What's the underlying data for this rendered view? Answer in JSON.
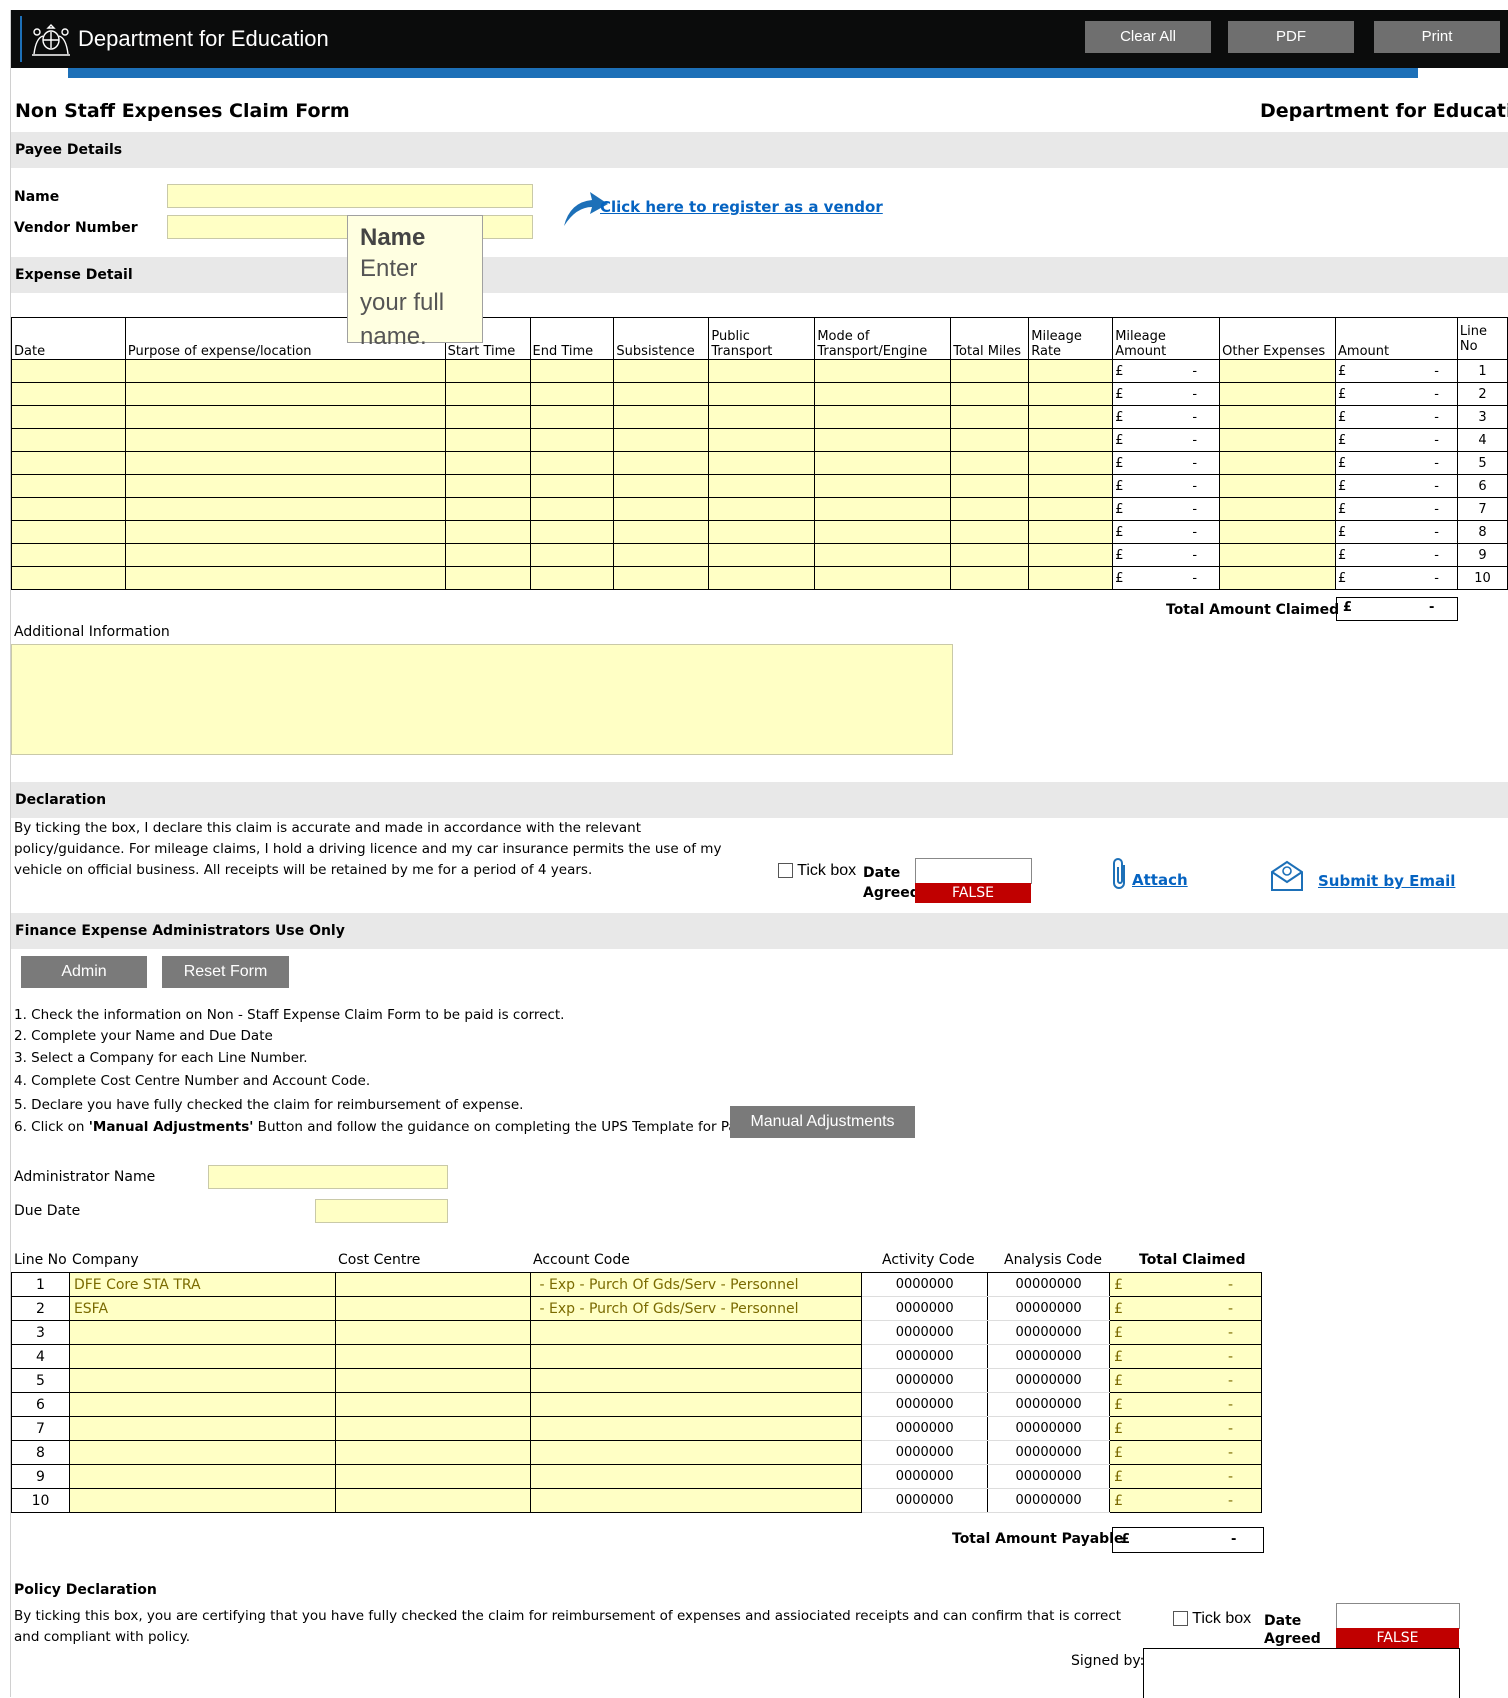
{
  "header": {
    "dept_name": "Department for Education",
    "buttons": [
      "Clear All",
      "PDF",
      "Print"
    ]
  },
  "form": {
    "title": "Non Staff Expenses Claim Form",
    "org": "Department for Education"
  },
  "payee": {
    "section": "Payee Details",
    "name_label": "Name",
    "vendor_label": "Vendor Number",
    "register_link": "Click here to register as a vendor",
    "tooltip_title": "Name",
    "tooltip_body": "Enter your full name."
  },
  "expense": {
    "section": "Expense Detail",
    "columns": [
      "Date",
      "Purpose of expense/location",
      "Start Time",
      "End Time",
      "Subsistence",
      "Public Transport",
      "Mode of Transport/Engine",
      "Total Miles",
      "Mileage Rate",
      "Mileage Amount",
      "Other Expenses",
      "Amount",
      "Line No"
    ],
    "currency": "£",
    "dash": "-",
    "line_numbers": [
      "1",
      "2",
      "3",
      "4",
      "5",
      "6",
      "7",
      "8",
      "9",
      "10"
    ],
    "total_label": "Total Amount Claimed"
  },
  "additional": {
    "label": "Additional Information"
  },
  "declaration": {
    "section": "Declaration",
    "text": "By ticking the box, I declare this claim is accurate and made in accordance with the relevant policy/guidance. For mileage claims, I hold a driving licence and my car insurance permits the use of my vehicle on official business. All receipts will be retained by me for a period of 4 years.",
    "tick_label": "Tick box",
    "date_label": "Date",
    "agreed_label": "Agreed",
    "agreed_value": "FALSE",
    "attach": "Attach",
    "submit": "Submit by Email"
  },
  "finance": {
    "section": "Finance Expense Administrators Use Only",
    "admin_btn": "Admin",
    "reset_btn": "Reset Form",
    "steps": [
      "1. Check the information on Non - Staff Expense Claim Form to be paid is correct.",
      "2. Complete your Name and Due Date",
      "3. Select a Company for each Line Number.",
      "4. Complete Cost Centre Number and Account Code.",
      "5. Declare you have fully checked the claim for reimbursement of expense."
    ],
    "step6_prefix": "6. Click on ",
    "step6_bold": "'Manual Adjustments'",
    "step6_suffix": " Button and follow the guidance on completing the UPS Template for Payr",
    "manual_btn": "Manual Adjustments",
    "admin_name_label": "Administrator Name",
    "due_date_label": "Due Date"
  },
  "admin_table": {
    "headers": [
      "Line No",
      "Company",
      "Cost Centre",
      "Account Code",
      "Activity Code",
      "Analysis Code",
      "Total Claimed"
    ],
    "rows": [
      {
        "line": "1",
        "company": "DFE Core STA TRA",
        "account": "- Exp - Purch Of Gds/Serv - Personnel"
      },
      {
        "line": "2",
        "company": "ESFA",
        "account": "- Exp - Purch Of Gds/Serv - Personnel"
      },
      {
        "line": "3",
        "company": "",
        "account": ""
      },
      {
        "line": "4",
        "company": "",
        "account": ""
      },
      {
        "line": "5",
        "company": "",
        "account": ""
      },
      {
        "line": "6",
        "company": "",
        "account": ""
      },
      {
        "line": "7",
        "company": "",
        "account": ""
      },
      {
        "line": "8",
        "company": "",
        "account": ""
      },
      {
        "line": "9",
        "company": "",
        "account": ""
      },
      {
        "line": "10",
        "company": "",
        "account": ""
      }
    ],
    "activity_code": "0000000",
    "analysis_code": "00000000",
    "total_payable_label": "Total Amount Payable"
  },
  "policy": {
    "section": "Policy Declaration",
    "text": "By ticking this box, you are certifying that you have fully checked the claim for reimbursement of expenses and assiociated receipts and can confirm that is correct and compliant with policy.",
    "tick_label": "Tick box",
    "date_label": "Date",
    "agreed_label": "Agreed",
    "agreed_value": "FALSE",
    "signed_label": "Signed by:"
  }
}
